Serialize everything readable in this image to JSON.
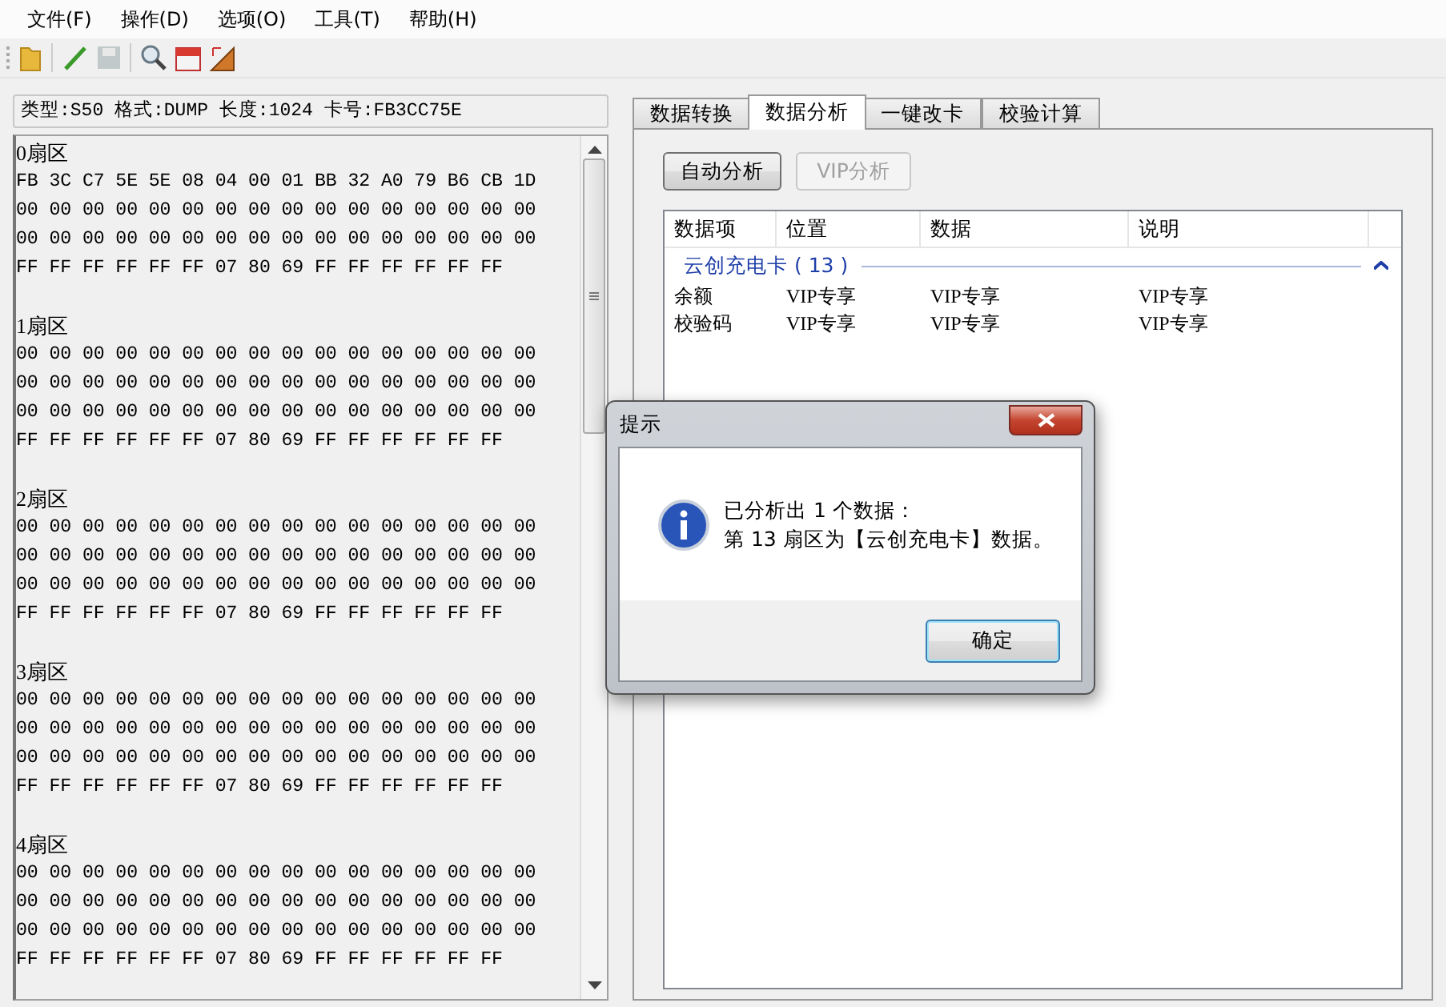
{
  "menu": [
    "文件(F)",
    "操作(D)",
    "选项(O)",
    "工具(T)",
    "帮助(H)"
  ],
  "toolbar": [
    {
      "kind": "folder",
      "disabled": false
    },
    {
      "kind": "separator"
    },
    {
      "kind": "pencil",
      "disabled": false
    },
    {
      "kind": "floppy",
      "disabled": true
    },
    {
      "kind": "separator"
    },
    {
      "kind": "magnifier",
      "disabled": false
    },
    {
      "kind": "calendar",
      "disabled": false
    },
    {
      "kind": "chart",
      "disabled": false
    }
  ],
  "file_info": "类型:S50 格式:DUMP 长度:1024 卡号:FB3CC75E",
  "hex_view": {
    "sectors": [
      {
        "title": "0扇区",
        "rows": [
          "FB 3C C7 5E 5E 08 04 00 01 BB 32 A0 79 B6 CB 1D",
          "00 00 00 00 00 00 00 00 00 00 00 00 00 00 00 00",
          "00 00 00 00 00 00 00 00 00 00 00 00 00 00 00 00",
          "FF FF FF FF FF FF 07 80 69 FF FF FF FF FF FF"
        ]
      },
      {
        "title": "1扇区",
        "rows": [
          "00 00 00 00 00 00 00 00 00 00 00 00 00 00 00 00",
          "00 00 00 00 00 00 00 00 00 00 00 00 00 00 00 00",
          "00 00 00 00 00 00 00 00 00 00 00 00 00 00 00 00",
          "FF FF FF FF FF FF 07 80 69 FF FF FF FF FF FF"
        ]
      },
      {
        "title": "2扇区",
        "rows": [
          "00 00 00 00 00 00 00 00 00 00 00 00 00 00 00 00",
          "00 00 00 00 00 00 00 00 00 00 00 00 00 00 00 00",
          "00 00 00 00 00 00 00 00 00 00 00 00 00 00 00 00",
          "FF FF FF FF FF FF 07 80 69 FF FF FF FF FF FF"
        ]
      },
      {
        "title": "3扇区",
        "rows": [
          "00 00 00 00 00 00 00 00 00 00 00 00 00 00 00 00",
          "00 00 00 00 00 00 00 00 00 00 00 00 00 00 00 00",
          "00 00 00 00 00 00 00 00 00 00 00 00 00 00 00 00",
          "FF FF FF FF FF FF 07 80 69 FF FF FF FF FF FF"
        ]
      },
      {
        "title": "4扇区",
        "rows": [
          "00 00 00 00 00 00 00 00 00 00 00 00 00 00 00 00",
          "00 00 00 00 00 00 00 00 00 00 00 00 00 00 00 00",
          "00 00 00 00 00 00 00 00 00 00 00 00 00 00 00 00",
          "FF FF FF FF FF FF 07 80 69 FF FF FF FF FF FF"
        ]
      }
    ]
  },
  "tabs": [
    {
      "label": "数据转换",
      "selected": false
    },
    {
      "label": "数据分析",
      "selected": true
    },
    {
      "label": "一键改卡",
      "selected": false
    },
    {
      "label": "校验计算",
      "selected": false
    }
  ],
  "buttons": [
    {
      "label": "自动分析",
      "disabled": false
    },
    {
      "label": "VIP分析",
      "disabled": true
    }
  ],
  "table": {
    "columns": [
      "数据项",
      "位置",
      "数据",
      "说明"
    ],
    "groups": [
      {
        "title": "云创充电卡 ( 13 )",
        "expanded": true,
        "rows": [
          [
            "余额",
            "VIP专享",
            "VIP专享",
            "VIP专享"
          ],
          [
            "校验码",
            "VIP专享",
            "VIP专享",
            "VIP专享"
          ]
        ]
      }
    ]
  },
  "dialog": {
    "title": "提示",
    "lines": [
      "已分析出 1 个数据：",
      "第 13 扇区为【云创充电卡】数据。"
    ],
    "button": "确定"
  }
}
